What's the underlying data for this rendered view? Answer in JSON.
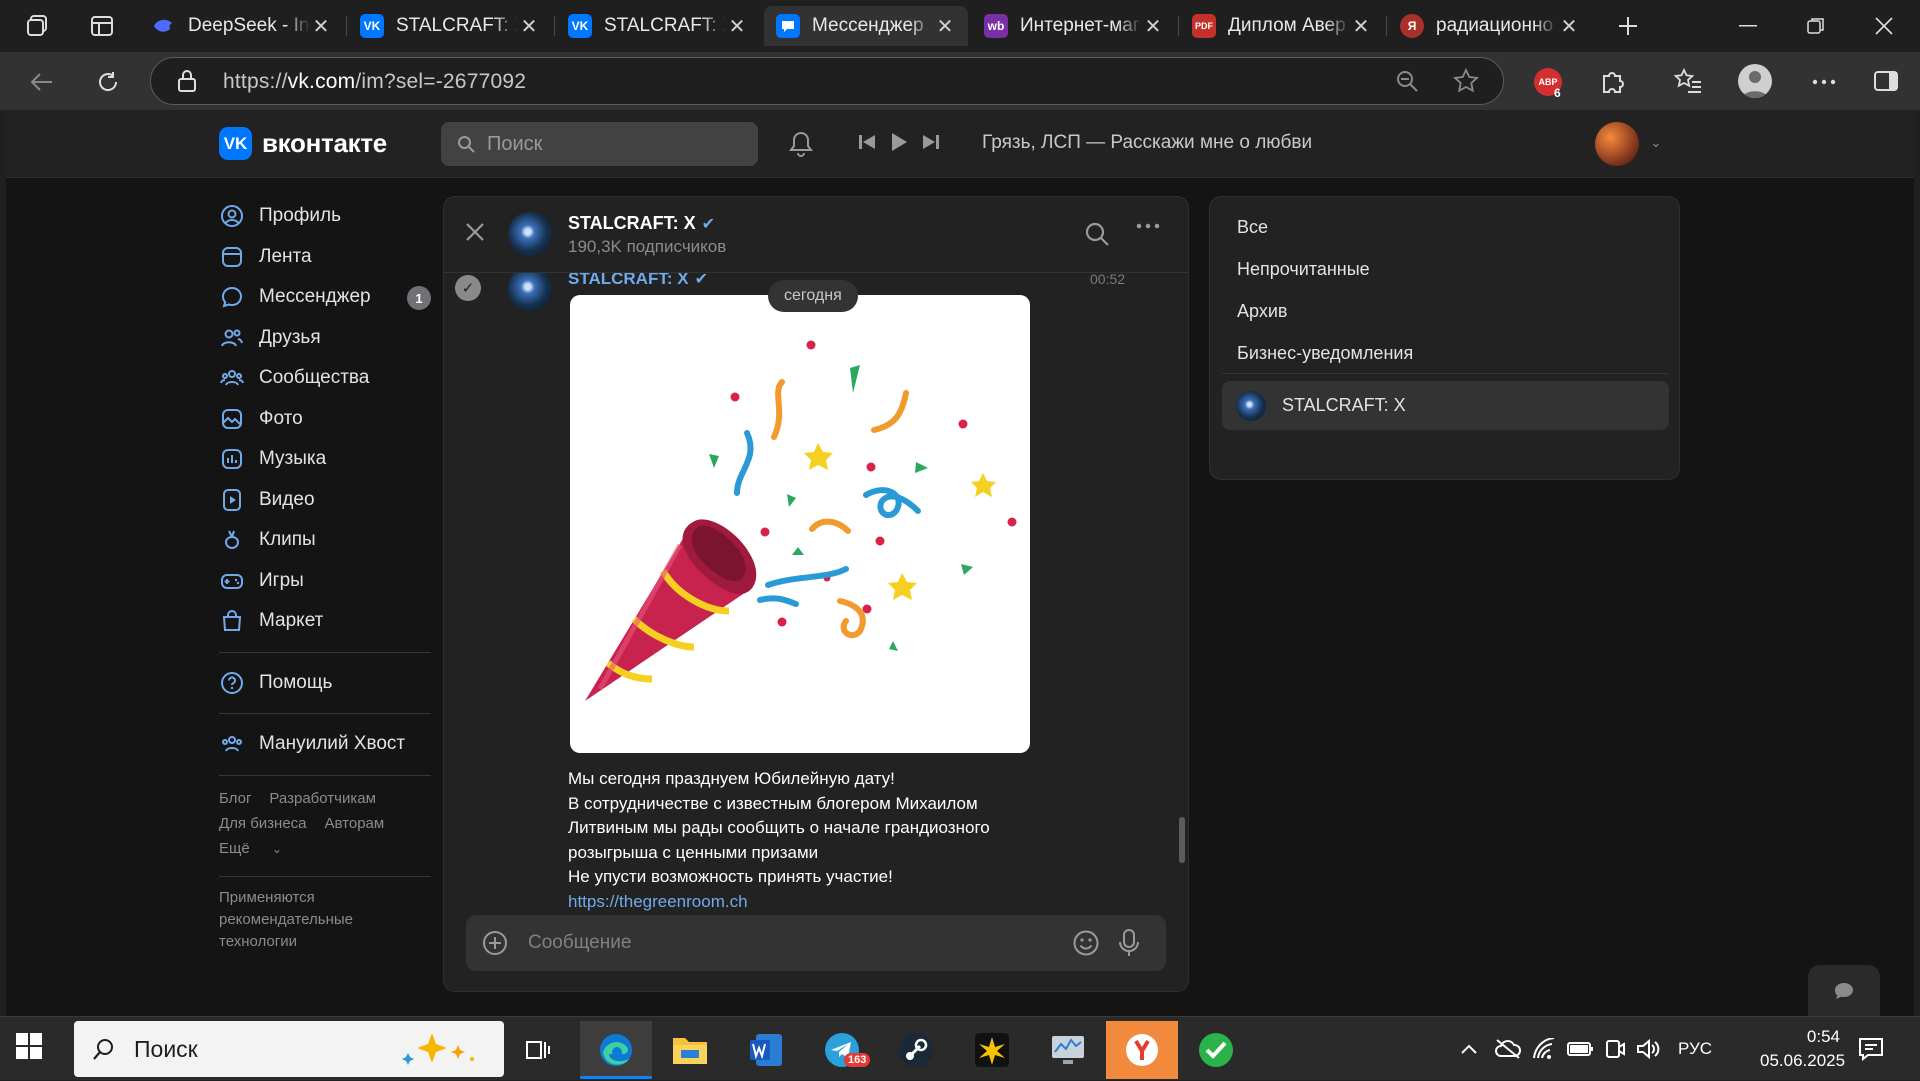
{
  "browser": {
    "tabs": [
      {
        "title": "DeepSeek - Int",
        "favicon": "deepseek-icon",
        "favicon_color": "#4d6bfe",
        "active": false
      },
      {
        "title": "STALCRAFT: X",
        "favicon": "vk-icon",
        "favicon_color": "#0077ff",
        "active": false
      },
      {
        "title": "STALCRAFT: X",
        "favicon": "vk-icon",
        "favicon_color": "#0077ff",
        "active": false
      },
      {
        "title": "Мессенджер",
        "favicon": "vk-messenger-icon",
        "favicon_color": "#0077ff",
        "active": true
      },
      {
        "title": "Интернет-маг",
        "favicon": "wildberries-icon",
        "favicon_color": "#7b2fa6",
        "active": false
      },
      {
        "title": "Диплом Авер",
        "favicon": "pdf-icon",
        "favicon_color": "#c4312b",
        "active": false
      },
      {
        "title": "радиационно",
        "favicon": "yandex-icon",
        "favicon_color": "#a8312b",
        "active": false
      }
    ],
    "url_prefix": "https://",
    "url_host": "vk.com",
    "url_path": "/im?sel=-2677092",
    "extension_badge": "ABP",
    "extension_count": "6"
  },
  "vk": {
    "logo_text": "вконтакте",
    "search_placeholder": "Поиск",
    "now_playing": "Грязь, ЛСП — Расскажи мне о любви",
    "menu": [
      {
        "label": "Профиль",
        "icon": "profile-icon"
      },
      {
        "label": "Лента",
        "icon": "feed-icon"
      },
      {
        "label": "Мессенджер",
        "icon": "messenger-icon",
        "badge": "1"
      },
      {
        "label": "Друзья",
        "icon": "friends-icon"
      },
      {
        "label": "Сообщества",
        "icon": "communities-icon"
      },
      {
        "label": "Фото",
        "icon": "photo-icon"
      },
      {
        "label": "Музыка",
        "icon": "music-icon"
      },
      {
        "label": "Видео",
        "icon": "video-icon"
      },
      {
        "label": "Клипы",
        "icon": "clips-icon"
      },
      {
        "label": "Игры",
        "icon": "games-icon"
      },
      {
        "label": "Маркет",
        "icon": "market-icon"
      }
    ],
    "help_label": "Помощь",
    "community_label": "Мануилий Хвост",
    "footer_links": [
      "Блог",
      "Разработчикам",
      "Для бизнеса",
      "Авторам",
      "Ещё"
    ],
    "recommendation_note": "Применяются рекомендательные технологии"
  },
  "chat": {
    "title": "STALCRAFT: X",
    "subtitle": "190,3K подписчиков",
    "sender": "STALCRAFT: X",
    "time": "00:52",
    "date_divider": "сегодня",
    "message_lines": [
      "Мы сегодня празднуем Юбилейную дату!",
      "В сотрудничестве с известным блогером Михаилом",
      "Литвиным мы рады сообщить о начале грандиозного",
      "розыгрыша с ценными призами",
      "Не упусти возможность принять участие!"
    ],
    "message_link": "https://thegreenroom.ch",
    "composer_placeholder": "Сообщение"
  },
  "filters": {
    "items": [
      "Все",
      "Непрочитанные",
      "Архив",
      "Бизнес-уведомления"
    ],
    "active_chat": "STALCRAFT: X"
  },
  "taskbar": {
    "search_placeholder": "Поиск",
    "apps": [
      "task-view-icon",
      "edge-icon",
      "file-explorer-icon",
      "word-icon",
      "telegram-icon",
      "steam-icon",
      "nova-icon",
      "monitor-icon",
      "yandex-browser-icon",
      "checkmark-app-icon"
    ],
    "telegram_badge": "163",
    "language": "РУС",
    "time": "0:54",
    "date": "05.06.2025"
  },
  "colors": {
    "accent": "#0077ff",
    "link": "#71aaeb",
    "background": "#141414",
    "panel": "#222222"
  }
}
